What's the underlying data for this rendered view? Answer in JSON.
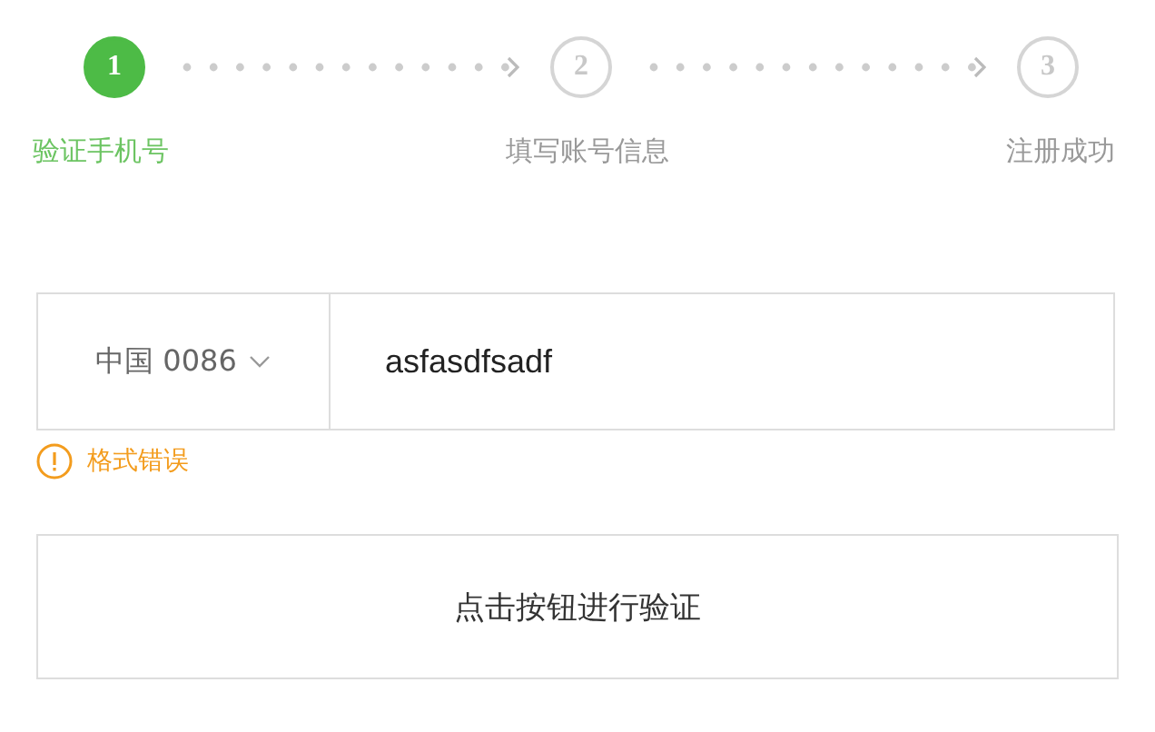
{
  "steps": [
    {
      "number": "1",
      "label": "验证手机号",
      "active": true
    },
    {
      "number": "2",
      "label": "填写账号信息",
      "active": false
    },
    {
      "number": "3",
      "label": "注册成功",
      "active": false
    }
  ],
  "phone": {
    "country": "中国 0086",
    "value": "asfasdfsadf"
  },
  "error": {
    "message": "格式错误"
  },
  "verify_button": {
    "label": "点击按钮进行验证"
  }
}
